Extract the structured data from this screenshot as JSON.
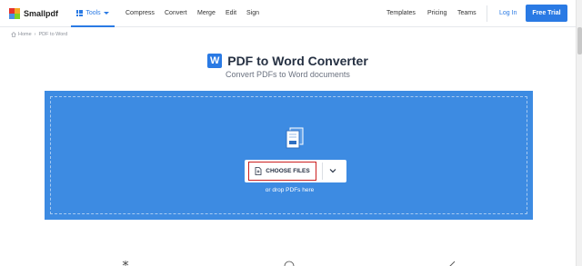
{
  "header": {
    "brand": "Smallpdf",
    "tools_label": "Tools",
    "nav": [
      "Compress",
      "Convert",
      "Merge",
      "Edit",
      "Sign"
    ],
    "right_nav": [
      "Templates",
      "Pricing",
      "Teams"
    ],
    "login_label": "Log In",
    "trial_label": "Free Trial"
  },
  "breadcrumb": {
    "home": "Home",
    "separator": "›",
    "current": "PDF to Word"
  },
  "hero": {
    "badge": "W",
    "title": "PDF to Word Converter",
    "subtitle": "Convert PDFs to Word documents"
  },
  "upload": {
    "choose_label": "CHOOSE FILES",
    "drop_hint": "or drop PDFs here"
  },
  "colors": {
    "accent": "#2a7ae4",
    "dropzone": "#3d8be2",
    "highlight": "#cc1f1f"
  },
  "icons": [
    "grid-icon",
    "home-icon",
    "file-stack-icon",
    "doc-plus-icon",
    "chevron-down-icon"
  ]
}
